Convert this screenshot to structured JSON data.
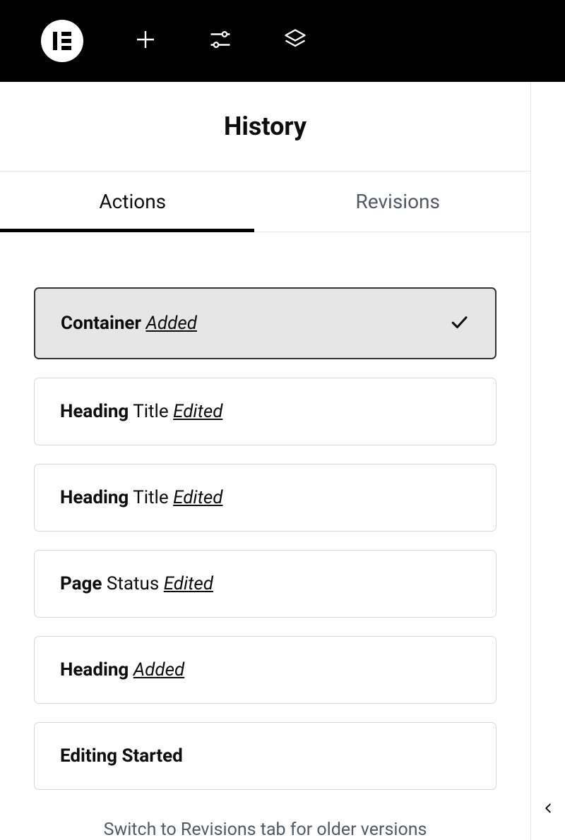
{
  "panel": {
    "title": "History"
  },
  "tabs": {
    "actions": "Actions",
    "revisions": "Revisions"
  },
  "history": {
    "items": [
      {
        "element": "Container",
        "subject": "",
        "action": "Added",
        "selected": true
      },
      {
        "element": "Heading",
        "subject": "Title",
        "action": "Edited",
        "selected": false
      },
      {
        "element": "Heading",
        "subject": "Title",
        "action": "Edited",
        "selected": false
      },
      {
        "element": "Page",
        "subject": "Status",
        "action": "Edited",
        "selected": false
      },
      {
        "element": "Heading",
        "subject": "",
        "action": "Added",
        "selected": false
      },
      {
        "element": "Editing Started",
        "subject": "",
        "action": "",
        "selected": false
      }
    ]
  },
  "footer": {
    "hint": "Switch to Revisions tab for older versions"
  }
}
